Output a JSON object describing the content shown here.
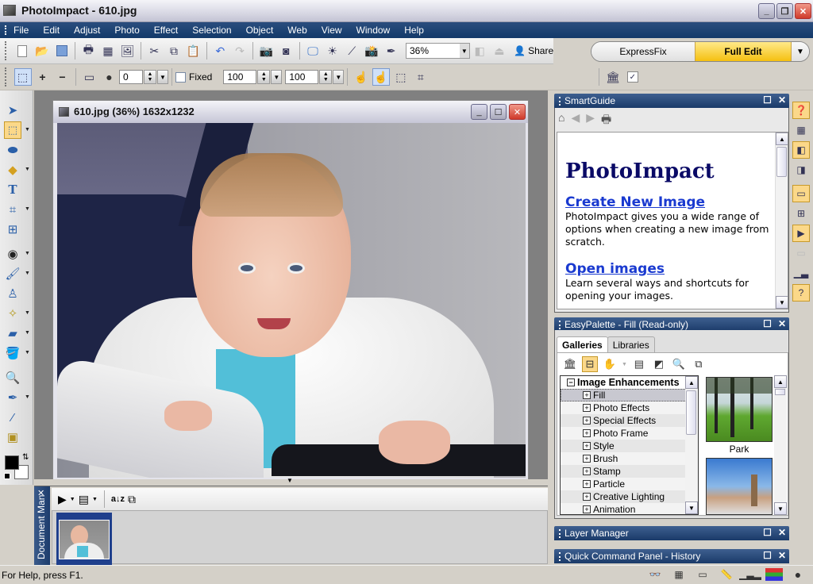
{
  "window": {
    "title": "PhotoImpact - 610.jpg",
    "minimize_label": "_",
    "restore_label": "❐",
    "close_label": "✕"
  },
  "menu": [
    {
      "label": "File",
      "mnemonic": "F"
    },
    {
      "label": "Edit",
      "mnemonic": "E"
    },
    {
      "label": "Adjust",
      "mnemonic": "A"
    },
    {
      "label": "Photo",
      "mnemonic": "t"
    },
    {
      "label": "Effect",
      "mnemonic": "c"
    },
    {
      "label": "Selection",
      "mnemonic": "l"
    },
    {
      "label": "Object",
      "mnemonic": "O"
    },
    {
      "label": "Web",
      "mnemonic": "b"
    },
    {
      "label": "View",
      "mnemonic": "V"
    },
    {
      "label": "Window",
      "mnemonic": "W"
    },
    {
      "label": "Help",
      "mnemonic": "H"
    }
  ],
  "toolbar": {
    "zoom_value": "36%",
    "share_label": "Share"
  },
  "mode_switch": {
    "express_label": "ExpressFix",
    "full_label": "Full Edit",
    "active": "Full Edit"
  },
  "options_bar": {
    "soft_edge_value": "0",
    "fixed_label": "Fixed",
    "fixed_checked": false,
    "width_value": "100",
    "height_value": "100"
  },
  "document": {
    "title": "610.jpg (36%) 1632x1232",
    "filename": "610.jpg",
    "zoom": "36%",
    "dimensions": "1632x1232"
  },
  "document_manager": {
    "label": "Document Man",
    "close_label": "✕"
  },
  "smartguide": {
    "title": "SmartGuide",
    "heading": "PhotoImpact",
    "sections": [
      {
        "link": "Create New Image",
        "text": "PhotoImpact gives you a wide range of options when creating a new image from scratch."
      },
      {
        "link": "Open images",
        "text": "Learn several ways and shortcuts for opening your images."
      }
    ]
  },
  "easypalette": {
    "title": "EasyPalette - Fill (Read-only)",
    "tabs": [
      "Galleries",
      "Libraries"
    ],
    "active_tab": "Galleries",
    "tree_root": "Image Enhancements",
    "tree_items": [
      "Fill",
      "Photo Effects",
      "Special Effects",
      "Photo Frame",
      "Style",
      "Brush",
      "Stamp",
      "Particle",
      "Creative Lighting",
      "Animation"
    ],
    "selected_item": "Fill",
    "gallery": [
      {
        "label": "Park"
      },
      {
        "label": ""
      }
    ]
  },
  "collapsed_panels": [
    {
      "title": "Layer Manager"
    },
    {
      "title": "Quick Command Panel - History"
    }
  ],
  "statusbar": {
    "help_text": "For Help, press F1."
  }
}
